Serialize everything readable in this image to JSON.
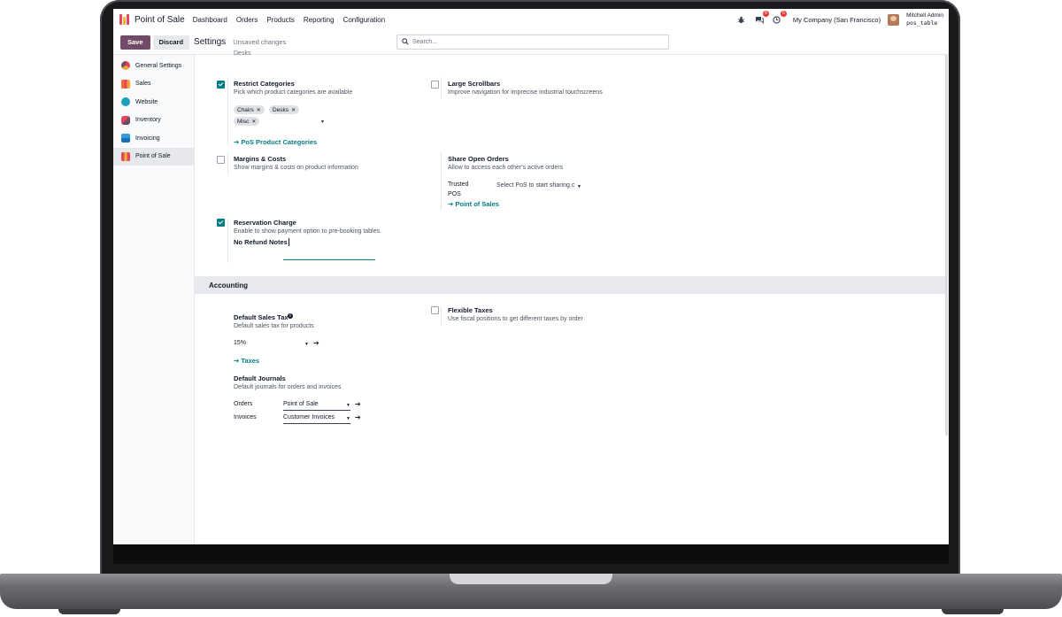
{
  "navbar": {
    "app_title": "Point of Sale",
    "menu": [
      "Dashboard",
      "Orders",
      "Products",
      "Reporting",
      "Configuration"
    ],
    "messages_badge": "6",
    "activity_badge": "6",
    "company": "My Company (San Francisco)",
    "user_name": "Mitchell Admin",
    "database": "pos_table"
  },
  "controlbar": {
    "save_label": "Save",
    "discard_label": "Discard",
    "title": "Settings",
    "unsaved": "Unsaved changes",
    "search_placeholder": "Search..."
  },
  "sidebar": {
    "items": [
      {
        "label": "General Settings",
        "color": "#e2445c"
      },
      {
        "label": "Sales",
        "color": "#f06a3a"
      },
      {
        "label": "Website",
        "color": "#1b9fb8"
      },
      {
        "label": "Inventory",
        "color": "#e8475b"
      },
      {
        "label": "Invoicing",
        "color": "#2f9ee0"
      },
      {
        "label": "Point of Sale",
        "color": "#e8963a"
      }
    ]
  },
  "settings": {
    "cut_text": "Desks",
    "restrict_categories": {
      "label": "Restrict Categories",
      "desc": "Pick which product categories are available",
      "checked": true,
      "tags": [
        "Chairs",
        "Desks",
        "Misc"
      ],
      "link": "PoS Product Categories"
    },
    "large_scrollbars": {
      "label": "Large Scrollbars",
      "desc": "Improve navigation for imprecise industrial touchscreens",
      "checked": false
    },
    "margins_costs": {
      "label": "Margins & Costs",
      "desc": "Show margins & costs on product information",
      "checked": false
    },
    "share_open_orders": {
      "label": "Share Open Orders",
      "desc": "Allow to access each other's active orders",
      "trusted_label_1": "Trusted",
      "trusted_label_2": "POS",
      "trusted_placeholder": "Select PoS to start sharing c",
      "link": "Point of Sales"
    },
    "reservation_charge": {
      "label": "Reservation Charge",
      "desc": "Enable to show payment option to pre-booking tables.",
      "checked": true,
      "note_label": "No Refund Notes"
    },
    "accounting": {
      "section_title": "Accounting",
      "default_sales_tax": {
        "label": "Default Sales Tax",
        "info_icon": "info-icon",
        "desc": "Default sales tax for products",
        "value": "15%",
        "link": "Taxes"
      },
      "flexible_taxes": {
        "label": "Flexible Taxes",
        "desc": "Use fiscal positions to get different taxes by order",
        "checked": false
      },
      "default_journals": {
        "label": "Default Journals",
        "desc": "Default journals for orders and invoices",
        "orders_label": "Orders",
        "orders_value": "Point of Sale",
        "invoices_label": "Invoices",
        "invoices_value": "Customer Invoices"
      }
    }
  },
  "colors": {
    "primary": "#714b67",
    "teal": "#017e84",
    "badge": "#e53935"
  }
}
